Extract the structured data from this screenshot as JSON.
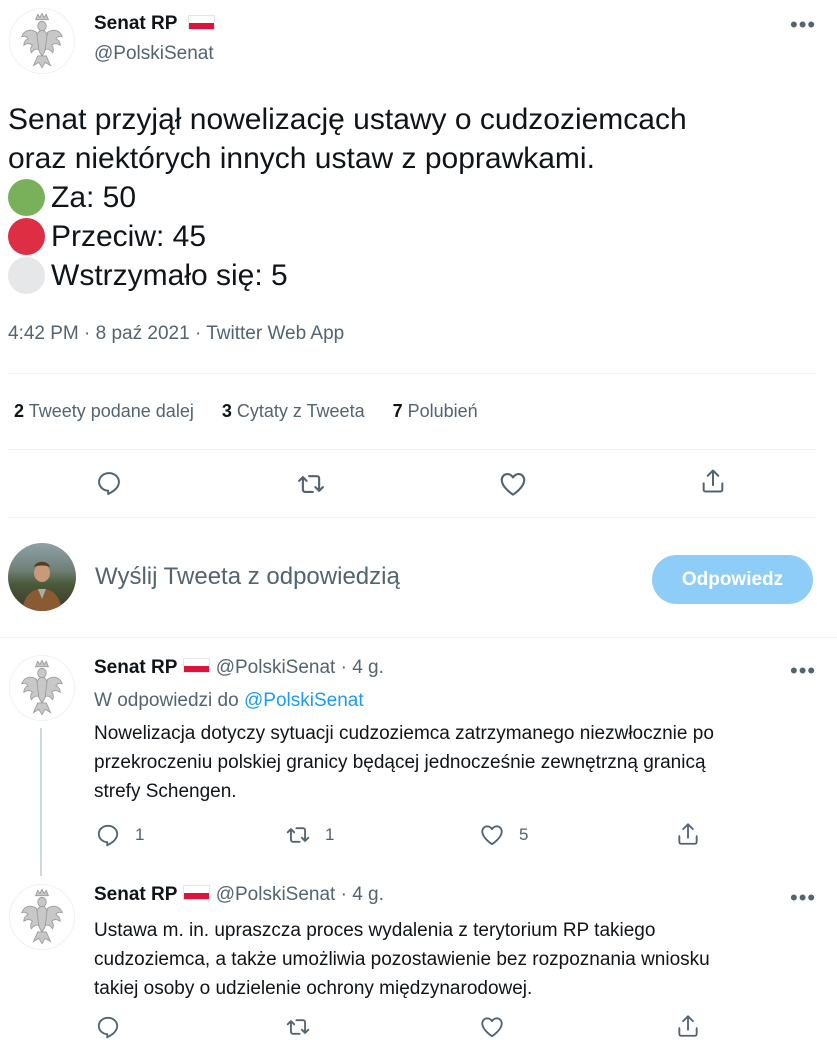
{
  "main_tweet": {
    "author_name": "Senat RP",
    "author_handle": "@PolskiSenat",
    "more_label": "•••",
    "text_line1": "Senat przyjął nowelizację ustawy o cudzoziemcach",
    "text_line2": "oraz niektórych innych ustaw z poprawkami.",
    "votes": [
      {
        "label": "Za: 50",
        "color": "#78b159"
      },
      {
        "label": "Przeciw: 45",
        "color": "#dd2e44"
      },
      {
        "label": "Wstrzymało się: 5",
        "color": "#e6e7e8"
      }
    ],
    "timestamp": "4:42 PM · 8 paź 2021 · Twitter Web App",
    "stats": {
      "retweets_count": "2",
      "retweets_label": "Tweety podane dalej",
      "quotes_count": "3",
      "quotes_label": "Cytaty z Tweeta",
      "likes_count": "7",
      "likes_label": "Polubień"
    },
    "actions": [
      "reply-icon",
      "retweet-icon",
      "like-icon",
      "share-icon"
    ]
  },
  "compose": {
    "placeholder": "Wyślij Tweeta z odpowiedzią",
    "button_label": "Odpowiedz",
    "button_color": "#8ecdf8"
  },
  "replies": [
    {
      "author_name": "Senat RP",
      "author_handle": "@PolskiSenat",
      "time": "· 4 g.",
      "reply_to_prefix": "W odpowiedzi do",
      "reply_to_handle": "@PolskiSenat",
      "lines": [
        "Nowelizacja dotyczy sytuacji cudzoziemca zatrzymanego niezwłocznie po",
        "przekroczeniu polskiej granicy będącej jednocześnie zewnętrzną granicą",
        "strefy Schengen."
      ],
      "reply_count": "1",
      "retweet_count": "1",
      "like_count": "5"
    },
    {
      "author_name": "Senat RP",
      "author_handle": "@PolskiSenat",
      "time": "· 4 g.",
      "lines": [
        "Ustawa m. in. upraszcza proces wydalenia z terytorium RP takiego",
        "cudzoziemca, a także umożliwia pozostawienie bez rozpoznania wniosku",
        "takiej osoby o udzielenie ochrony międzynarodowej."
      ]
    }
  ],
  "colors": {
    "text": "#0f1419",
    "secondary": "#536471",
    "link": "#1d9bf0",
    "divider": "#eff3f4"
  }
}
